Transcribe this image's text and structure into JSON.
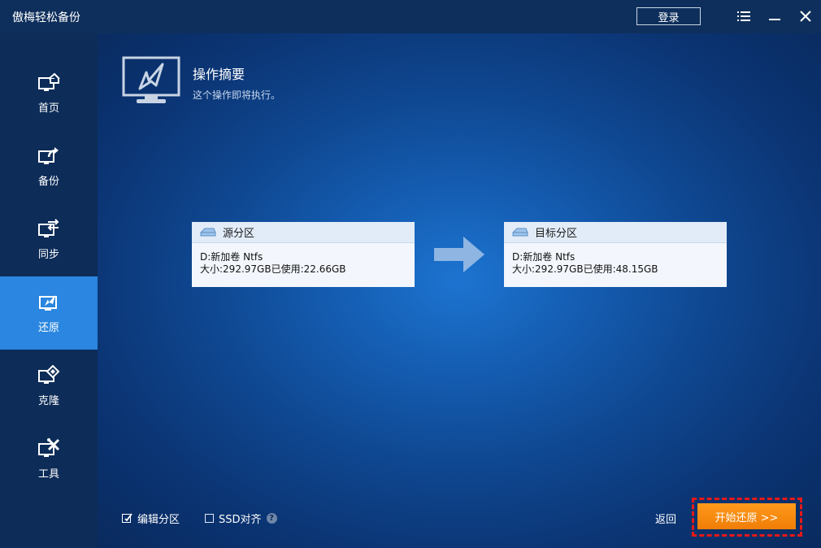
{
  "app": {
    "title": "傲梅轻松备份"
  },
  "titlebar": {
    "login_label": "登录"
  },
  "sidebar": {
    "items": [
      {
        "label": "首页",
        "icon": "home-monitor-icon"
      },
      {
        "label": "备份",
        "icon": "backup-monitor-icon"
      },
      {
        "label": "同步",
        "icon": "sync-monitor-icon"
      },
      {
        "label": "还原",
        "icon": "restore-monitor-icon",
        "active": true
      },
      {
        "label": "克隆",
        "icon": "clone-monitor-icon"
      },
      {
        "label": "工具",
        "icon": "tools-monitor-icon"
      }
    ]
  },
  "summary": {
    "title": "操作摘要",
    "subtitle": "这个操作即将执行。"
  },
  "source": {
    "title": "源分区",
    "line1": "D:新加卷 Ntfs",
    "line2": "大小:292.97GB已使用:22.66GB"
  },
  "target": {
    "title": "目标分区",
    "line1": "D:新加卷 Ntfs",
    "line2": "大小:292.97GB已使用:48.15GB"
  },
  "options": {
    "edit_partition": "编辑分区",
    "ssd_align": "SSD对齐",
    "help": "?"
  },
  "actions": {
    "back": "返回",
    "start": "开始还原 >>"
  },
  "colors": {
    "accent": "#2a86e0",
    "start_button": "#f7890f",
    "highlight": "#e81818"
  }
}
